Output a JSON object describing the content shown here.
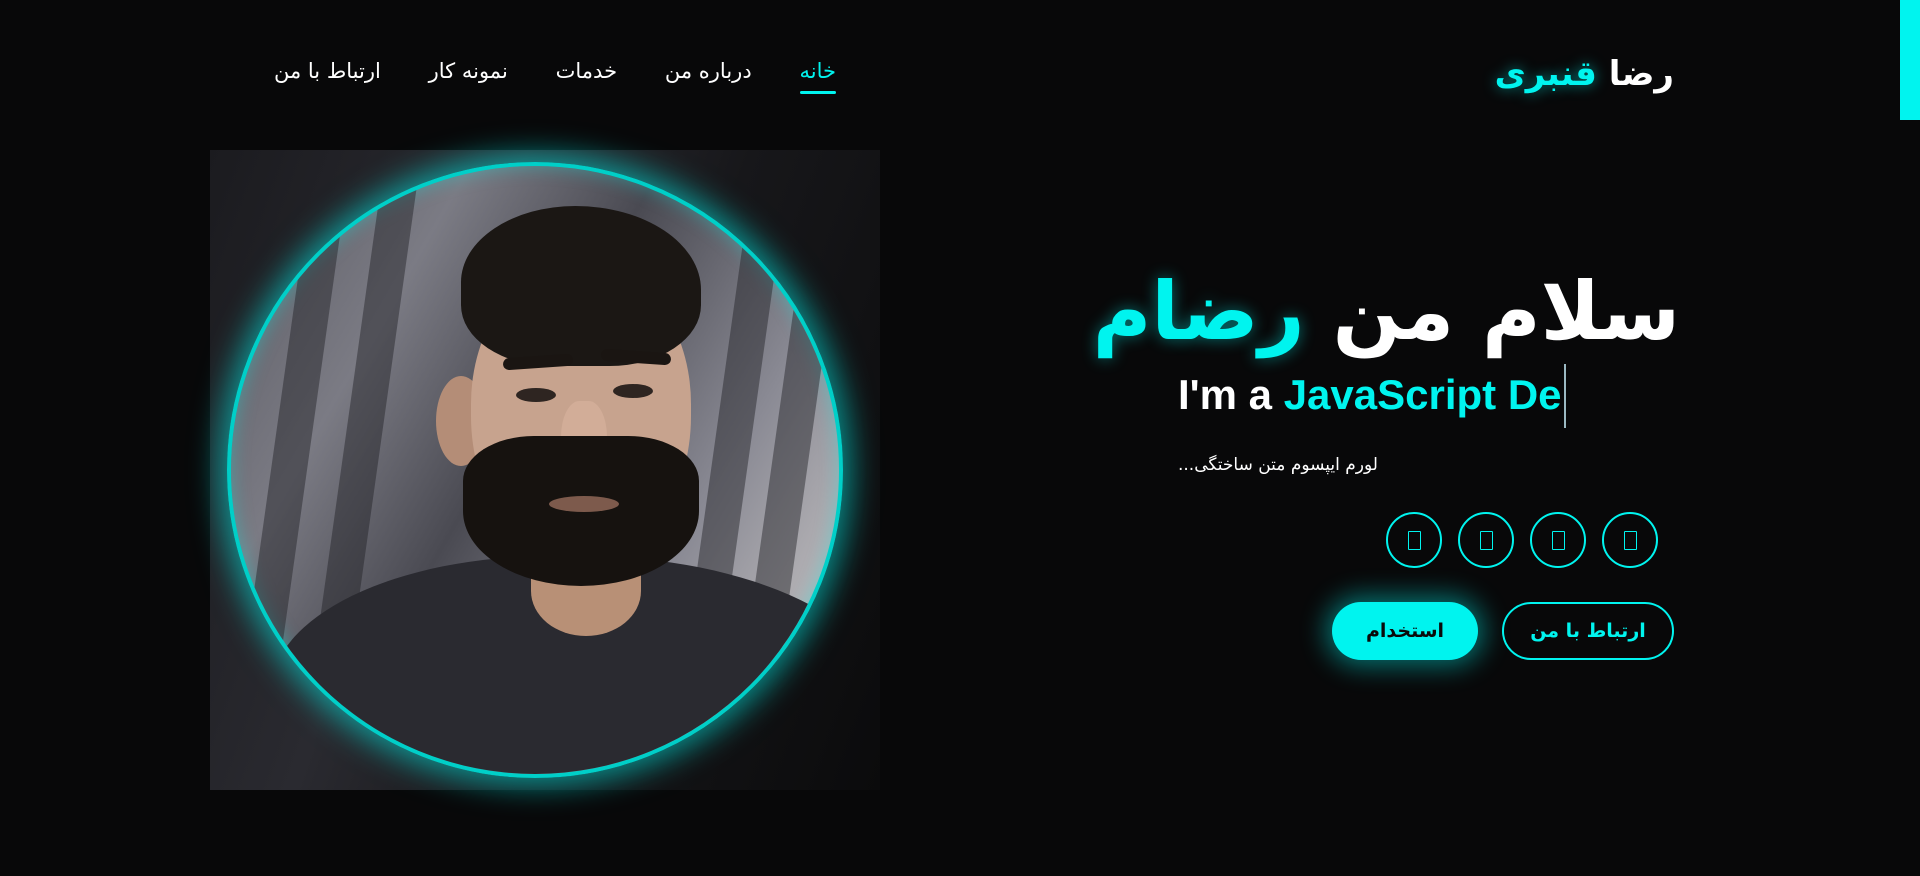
{
  "brand": {
    "first_name": "رضا",
    "last_name": "قنبری"
  },
  "nav": {
    "items": [
      {
        "label": "خانه",
        "active": true
      },
      {
        "label": "درباره من",
        "active": false
      },
      {
        "label": "خدمات",
        "active": false
      },
      {
        "label": "نمونه کار",
        "active": false
      },
      {
        "label": "ارتباط با من",
        "active": false
      }
    ]
  },
  "hero": {
    "greeting": "سلام من",
    "name": "رضام",
    "typed_prefix": "I'm a",
    "typed_role": "JavaScript De",
    "intro": "لورم ایپسوم متن ساختگی..."
  },
  "socials": [
    {
      "icon": "social-icon-1"
    },
    {
      "icon": "social-icon-2"
    },
    {
      "icon": "social-icon-3"
    },
    {
      "icon": "social-icon-4"
    }
  ],
  "buttons": {
    "hire_label": "استخدام",
    "contact_label": "ارتباط با من"
  },
  "colors": {
    "accent": "#00f4ef",
    "background": "#080809",
    "text": "#ffffff"
  }
}
